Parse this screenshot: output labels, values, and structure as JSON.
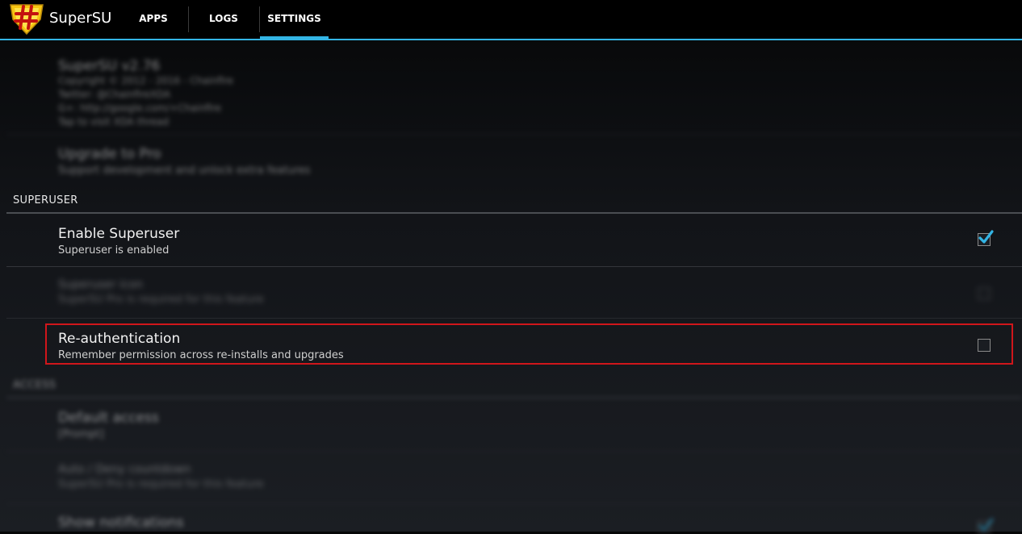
{
  "app": {
    "title": "SuperSU"
  },
  "tabs": [
    {
      "label": "APPS"
    },
    {
      "label": "LOGS"
    },
    {
      "label": "SETTINGS",
      "selected": true
    }
  ],
  "about": {
    "title": "SuperSU v2.76",
    "lines": [
      "Copyright © 2012 - 2016 - Chainfire",
      "Twitter: @ChainfireXDA",
      "G+: http://google.com/+Chainfire",
      "Tap to visit XDA thread"
    ]
  },
  "upgrade": {
    "title": "Upgrade to Pro",
    "subtitle": "Support development and unlock extra features"
  },
  "superuser_section": {
    "header": "SUPERUSER"
  },
  "enable_superuser": {
    "title": "Enable Superuser",
    "subtitle": "Superuser is enabled",
    "checked": true
  },
  "superuser_icon": {
    "title": "Superuser icon",
    "subtitle": "SuperSU Pro is required for this feature"
  },
  "reauthentication": {
    "title": "Re-authentication",
    "subtitle": "Remember permission across re-installs and upgrades",
    "checked": false
  },
  "access_section": {
    "header": "ACCESS"
  },
  "default_access": {
    "title": "Default access",
    "subtitle": "[Prompt]"
  },
  "auto_deny": {
    "title": "Auto / Deny countdown",
    "subtitle": "SuperSU Pro is required for this feature"
  },
  "show_notifications": {
    "title": "Show notifications"
  },
  "colors": {
    "accent": "#33b5e5",
    "highlight": "#d0161b"
  }
}
